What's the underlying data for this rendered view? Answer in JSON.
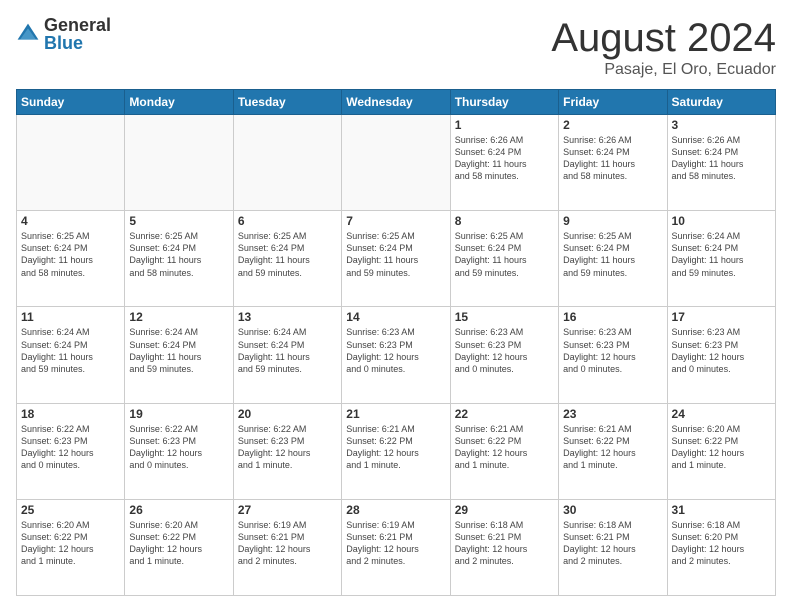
{
  "header": {
    "logo_general": "General",
    "logo_blue": "Blue",
    "month_title": "August 2024",
    "subtitle": "Pasaje, El Oro, Ecuador"
  },
  "days_of_week": [
    "Sunday",
    "Monday",
    "Tuesday",
    "Wednesday",
    "Thursday",
    "Friday",
    "Saturday"
  ],
  "weeks": [
    [
      {
        "day": "",
        "info": ""
      },
      {
        "day": "",
        "info": ""
      },
      {
        "day": "",
        "info": ""
      },
      {
        "day": "",
        "info": ""
      },
      {
        "day": "1",
        "info": "Sunrise: 6:26 AM\nSunset: 6:24 PM\nDaylight: 11 hours\nand 58 minutes."
      },
      {
        "day": "2",
        "info": "Sunrise: 6:26 AM\nSunset: 6:24 PM\nDaylight: 11 hours\nand 58 minutes."
      },
      {
        "day": "3",
        "info": "Sunrise: 6:26 AM\nSunset: 6:24 PM\nDaylight: 11 hours\nand 58 minutes."
      }
    ],
    [
      {
        "day": "4",
        "info": "Sunrise: 6:25 AM\nSunset: 6:24 PM\nDaylight: 11 hours\nand 58 minutes."
      },
      {
        "day": "5",
        "info": "Sunrise: 6:25 AM\nSunset: 6:24 PM\nDaylight: 11 hours\nand 58 minutes."
      },
      {
        "day": "6",
        "info": "Sunrise: 6:25 AM\nSunset: 6:24 PM\nDaylight: 11 hours\nand 59 minutes."
      },
      {
        "day": "7",
        "info": "Sunrise: 6:25 AM\nSunset: 6:24 PM\nDaylight: 11 hours\nand 59 minutes."
      },
      {
        "day": "8",
        "info": "Sunrise: 6:25 AM\nSunset: 6:24 PM\nDaylight: 11 hours\nand 59 minutes."
      },
      {
        "day": "9",
        "info": "Sunrise: 6:25 AM\nSunset: 6:24 PM\nDaylight: 11 hours\nand 59 minutes."
      },
      {
        "day": "10",
        "info": "Sunrise: 6:24 AM\nSunset: 6:24 PM\nDaylight: 11 hours\nand 59 minutes."
      }
    ],
    [
      {
        "day": "11",
        "info": "Sunrise: 6:24 AM\nSunset: 6:24 PM\nDaylight: 11 hours\nand 59 minutes."
      },
      {
        "day": "12",
        "info": "Sunrise: 6:24 AM\nSunset: 6:24 PM\nDaylight: 11 hours\nand 59 minutes."
      },
      {
        "day": "13",
        "info": "Sunrise: 6:24 AM\nSunset: 6:24 PM\nDaylight: 11 hours\nand 59 minutes."
      },
      {
        "day": "14",
        "info": "Sunrise: 6:23 AM\nSunset: 6:23 PM\nDaylight: 12 hours\nand 0 minutes."
      },
      {
        "day": "15",
        "info": "Sunrise: 6:23 AM\nSunset: 6:23 PM\nDaylight: 12 hours\nand 0 minutes."
      },
      {
        "day": "16",
        "info": "Sunrise: 6:23 AM\nSunset: 6:23 PM\nDaylight: 12 hours\nand 0 minutes."
      },
      {
        "day": "17",
        "info": "Sunrise: 6:23 AM\nSunset: 6:23 PM\nDaylight: 12 hours\nand 0 minutes."
      }
    ],
    [
      {
        "day": "18",
        "info": "Sunrise: 6:22 AM\nSunset: 6:23 PM\nDaylight: 12 hours\nand 0 minutes."
      },
      {
        "day": "19",
        "info": "Sunrise: 6:22 AM\nSunset: 6:23 PM\nDaylight: 12 hours\nand 0 minutes."
      },
      {
        "day": "20",
        "info": "Sunrise: 6:22 AM\nSunset: 6:23 PM\nDaylight: 12 hours\nand 1 minute."
      },
      {
        "day": "21",
        "info": "Sunrise: 6:21 AM\nSunset: 6:22 PM\nDaylight: 12 hours\nand 1 minute."
      },
      {
        "day": "22",
        "info": "Sunrise: 6:21 AM\nSunset: 6:22 PM\nDaylight: 12 hours\nand 1 minute."
      },
      {
        "day": "23",
        "info": "Sunrise: 6:21 AM\nSunset: 6:22 PM\nDaylight: 12 hours\nand 1 minute."
      },
      {
        "day": "24",
        "info": "Sunrise: 6:20 AM\nSunset: 6:22 PM\nDaylight: 12 hours\nand 1 minute."
      }
    ],
    [
      {
        "day": "25",
        "info": "Sunrise: 6:20 AM\nSunset: 6:22 PM\nDaylight: 12 hours\nand 1 minute."
      },
      {
        "day": "26",
        "info": "Sunrise: 6:20 AM\nSunset: 6:22 PM\nDaylight: 12 hours\nand 1 minute."
      },
      {
        "day": "27",
        "info": "Sunrise: 6:19 AM\nSunset: 6:21 PM\nDaylight: 12 hours\nand 2 minutes."
      },
      {
        "day": "28",
        "info": "Sunrise: 6:19 AM\nSunset: 6:21 PM\nDaylight: 12 hours\nand 2 minutes."
      },
      {
        "day": "29",
        "info": "Sunrise: 6:18 AM\nSunset: 6:21 PM\nDaylight: 12 hours\nand 2 minutes."
      },
      {
        "day": "30",
        "info": "Sunrise: 6:18 AM\nSunset: 6:21 PM\nDaylight: 12 hours\nand 2 minutes."
      },
      {
        "day": "31",
        "info": "Sunrise: 6:18 AM\nSunset: 6:20 PM\nDaylight: 12 hours\nand 2 minutes."
      }
    ]
  ]
}
